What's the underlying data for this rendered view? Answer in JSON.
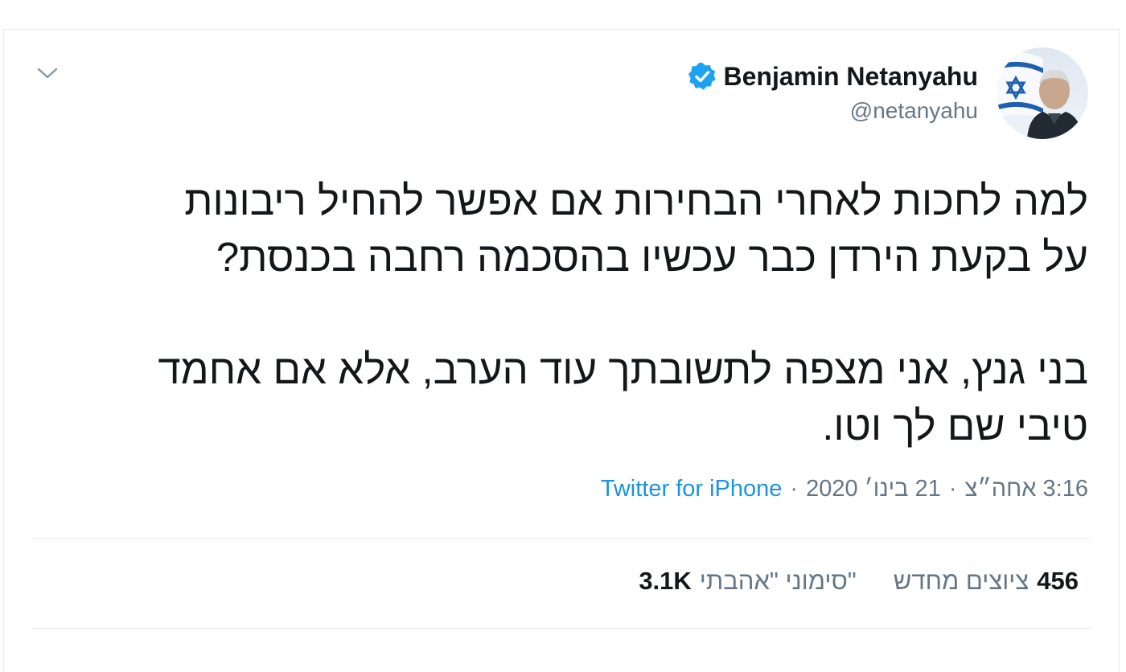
{
  "user": {
    "display_name": "Benjamin Netanyahu",
    "handle": "@netanyahu",
    "verified": true,
    "avatar_icon": "profile-photo-with-israeli-flag"
  },
  "tweet": {
    "paragraphs": [
      [
        "למה לחכות לאחרי הבחירות אם אפשר להחיל ריבונות",
        "על בקעת הירדן כבר עכשיו בהסכמה רחבה בכנסת?"
      ],
      [
        "בני גנץ, אני מצפה לתשובתך עוד הערב, אלא אם אחמד",
        "טיבי שם לך וטו."
      ]
    ],
    "time": "3:16 אחה״צ",
    "date": "21 בינו׳ 2020",
    "separator": "·",
    "source": "Twitter for iPhone"
  },
  "stats": {
    "retweets_count": "456",
    "retweets_label": "ציוצים מחדש",
    "likes_count": "3.1K",
    "likes_label": "\"סימוני \"אהבתי"
  },
  "colors": {
    "text": "#14171a",
    "secondary": "#657786",
    "link": "#1b95e0",
    "verified": "#1da1f2",
    "border": "#e6ecf0"
  }
}
